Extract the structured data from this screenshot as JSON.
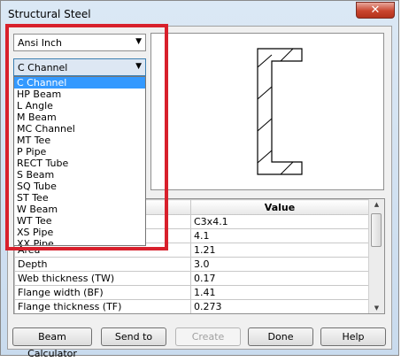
{
  "window": {
    "title": "Structural Steel",
    "close_glyph": "✕"
  },
  "standard_combo": {
    "selected": "Ansi Inch",
    "arrow": "▼"
  },
  "shape_combo": {
    "selected": "C Channel",
    "arrow": "▼",
    "options": [
      "C Channel",
      "HP Beam",
      "L Angle",
      "M Beam",
      "MC Channel",
      "MT Tee",
      "P Pipe",
      "RECT Tube",
      "S Beam",
      "SQ Tube",
      "ST Tee",
      "W Beam",
      "WT Tee",
      "XS Pipe",
      "XX Pipe"
    ]
  },
  "grid": {
    "value_header": "Value",
    "rows": [
      {
        "property": "",
        "value": "C3x4.1"
      },
      {
        "property": "",
        "value": "4.1"
      },
      {
        "property": "Area",
        "value": "1.21"
      },
      {
        "property": "Depth",
        "value": "3.0"
      },
      {
        "property": "Web thickness (TW)",
        "value": "0.17"
      },
      {
        "property": "Flange width (BF)",
        "value": "1.41"
      },
      {
        "property": "Flange thickness (TF)",
        "value": "0.273"
      }
    ]
  },
  "buttons": {
    "beam_calculator": "Beam Calculator",
    "send_to": "Send to",
    "create": "Create",
    "done": "Done",
    "help": "Help"
  },
  "colors": {
    "highlight": "#d8202c",
    "selection": "#3399ff",
    "close": "#c9452e"
  }
}
